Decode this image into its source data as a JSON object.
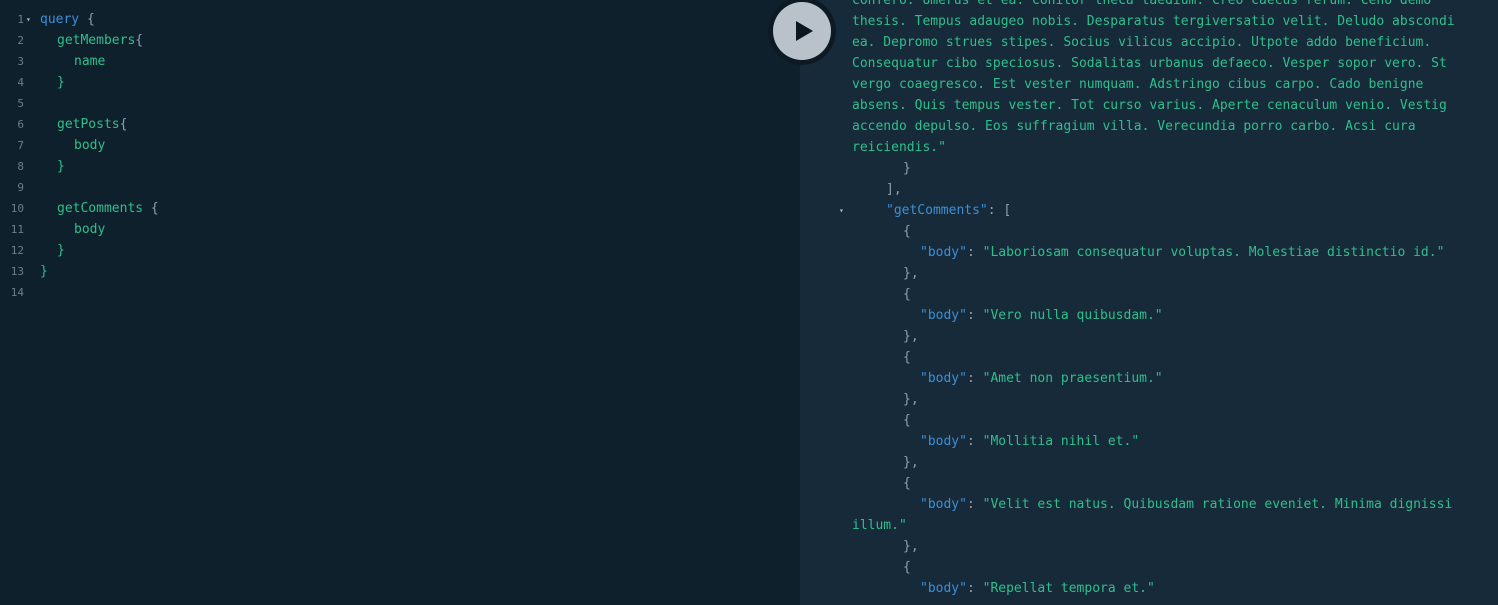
{
  "editor": {
    "line_numbers": [
      "1",
      "2",
      "3",
      "4",
      "5",
      "6",
      "7",
      "8",
      "9",
      "10",
      "11",
      "12",
      "13",
      "14"
    ],
    "fold_marker": "▾",
    "lines": {
      "l1_keyword": "query",
      "l1_brace": " {",
      "l2_field": "getMembers",
      "l2_brace": "{",
      "l3_field": "name",
      "l4_brace": "}",
      "l6_field": "getPosts",
      "l6_brace": "{",
      "l7_field": "body",
      "l8_brace": "}",
      "l10_field": "getComments",
      "l10_brace": " {",
      "l11_field": "body",
      "l12_brace": "}",
      "l13_brace": "}"
    }
  },
  "run_button": {
    "icon": "play-icon"
  },
  "result": {
    "fold_marker": "▾",
    "post_text_lines": [
      "confero. Umerus et ea. Conitor theca taedium. Creo caecus rerum. Ceno demo",
      "thesis. Tempus adaugeo nobis. Desparatus tergiversatio velit. Deludo abscondi",
      "ea. Depromo strues stipes. Socius vilicus accipio. Utpote addo beneficium.",
      "Consequatur cibo speciosus. Sodalitas urbanus defaeco. Vesper sopor vero. St",
      "vergo coaegresco. Est vester numquam. Adstringo cibus carpo. Cado benigne",
      "absens. Quis tempus vester. Tot curso varius. Aperte cenaculum venio. Vestig",
      "accendo depulso. Eos suffragium villa. Verecundia porro carbo. Acsi cura",
      "reiciendis.\""
    ],
    "close_obj": "}",
    "close_arr": "],",
    "comments_key": "\"getComments\"",
    "comments_open": ": [",
    "open_obj": "{",
    "close_obj_comma": "},",
    "body_key": "\"body\"",
    "colon": ": ",
    "comments": [
      "\"Laboriosam consequatur voluptas. Molestiae distinctio id.\"",
      "\"Vero nulla quibusdam.\"",
      "\"Amet non praesentium.\"",
      "\"Mollitia nihil et.\"",
      "\"Velit est natus. Quibusdam ratione eveniet. Minima dignissi",
      "\"Repellat tempora et.\""
    ],
    "comment5_wrap": "illum.\""
  }
}
